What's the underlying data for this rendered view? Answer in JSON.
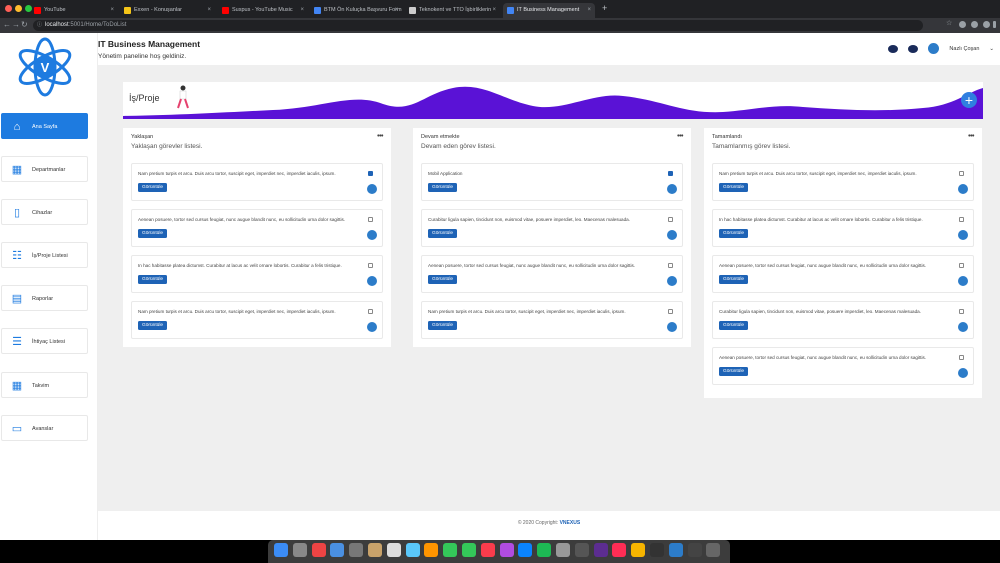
{
  "browser": {
    "tabs": [
      {
        "label": "YouTube",
        "color": "#ff0000"
      },
      {
        "label": "Exxen - Konuşanlar",
        "color": "#f5c518"
      },
      {
        "label": "Suspus - YouTube Music",
        "color": "#ff0000"
      },
      {
        "label": "BTM Ön Kuluçka Başvuru Form",
        "color": "#4285f4"
      },
      {
        "label": "Teknokent ve TTO İşbirliklerin",
        "color": "#cccccc"
      },
      {
        "label": "IT Business Management",
        "color": "#4285f4"
      }
    ],
    "url_host": "localhost",
    "url_path": ":5001/Home/ToDoList"
  },
  "app": {
    "title": "IT Business Management",
    "subtitle": "Yönetim paneline hoş geldiniz.",
    "user_name": "Nazlı Çoşan",
    "page_title": "İş/Proje",
    "add_label": "+"
  },
  "sidebar": {
    "items": [
      {
        "label": "Ana Sayfa",
        "icon": "home-icon",
        "glyph": "⌂"
      },
      {
        "label": "Departmanlar",
        "icon": "departments-icon",
        "glyph": "▦"
      },
      {
        "label": "Cihazlar",
        "icon": "device-icon",
        "glyph": "▯"
      },
      {
        "label": "İş/Proje Listesi",
        "icon": "checklist-icon",
        "glyph": "☷"
      },
      {
        "label": "Raporlar",
        "icon": "report-icon",
        "glyph": "▤"
      },
      {
        "label": "İhtiyaç Listesi",
        "icon": "list-icon",
        "glyph": "☰"
      },
      {
        "label": "Takvim",
        "icon": "calendar-icon",
        "glyph": "▦"
      },
      {
        "label": "Avanslar",
        "icon": "payment-icon",
        "glyph": "▭"
      }
    ]
  },
  "button_label": "Görüntüle",
  "columns": [
    {
      "title": "Yaklaşan",
      "subtitle": "Yaklaşan görevler listesi.",
      "menu": "•••",
      "cards": [
        {
          "text": "Nam pretium turpis et arcu. Duis arcu tortor, suscipit eget, imperdiet nec, imperdiet iaculis, ipsum.",
          "checked": true
        },
        {
          "text": "Aenean posuere, tortor sed cursus feugiat, nunc augue blandit nunc, eu sollicitudin urna dolor sagittis.",
          "checked": false
        },
        {
          "text": "In hac habitasse platea dictumst. Curabitur at lacus ac velit ornare lobortis. Curabitur a felis tristique.",
          "checked": false
        },
        {
          "text": "Nam pretium turpis et arcu. Duis arcu tortor, suscipit eget, imperdiet nec, imperdiet iaculis, ipsum.",
          "checked": false
        }
      ]
    },
    {
      "title": "Devam etmekte",
      "subtitle": "Devam eden görev listesi.",
      "menu": "•••",
      "cards": [
        {
          "text": "Mobil Application",
          "checked": true
        },
        {
          "text": "Curabitur ligula sapien, tincidunt non, euismod vitae, posuere imperdiet, leo. Maecenas malesuada.",
          "checked": false
        },
        {
          "text": "Aenean posuere, tortor sed cursus feugiat, nunc augue blandit nunc, eu sollicitudin urna dolor sagittis.",
          "checked": false
        },
        {
          "text": "Nam pretium turpis et arcu. Duis arcu tortor, suscipit eget, imperdiet nec, imperdiet iaculis, ipsum.",
          "checked": false
        }
      ]
    },
    {
      "title": "Tamamlandı",
      "subtitle": "Tamamlanmış görev listesi.",
      "menu": "•••",
      "cards": [
        {
          "text": "Nam pretium turpis et arcu. Duis arcu tortor, suscipit eget, imperdiet nec, imperdiet iaculis, ipsum.",
          "checked": false
        },
        {
          "text": "In hac habitasse platea dictumst. Curabitur at lacus ac velit ornare lobortis. Curabitur a felis tristique.",
          "checked": false
        },
        {
          "text": "Aenean posuere, tortor sed cursus feugiat, nunc augue blandit nunc, eu sollicitudin urna dolor sagittis.",
          "checked": false
        },
        {
          "text": "Curabitur ligula sapien, tincidunt non, euismod vitae, posuere imperdiet, leo. Maecenas malesuada.",
          "checked": false
        },
        {
          "text": "Aenean posuere, tortor sed cursus feugiat, nunc augue blandit nunc, eu sollicitudin urna dolor sagittis.",
          "checked": false
        }
      ]
    }
  ],
  "footer": {
    "prefix": "© 2020 Copyright:",
    "brand": "VNEXUS"
  },
  "colors": {
    "accent": "#1e7be0",
    "button": "#1e63b6",
    "wave": "#5a12d6"
  }
}
